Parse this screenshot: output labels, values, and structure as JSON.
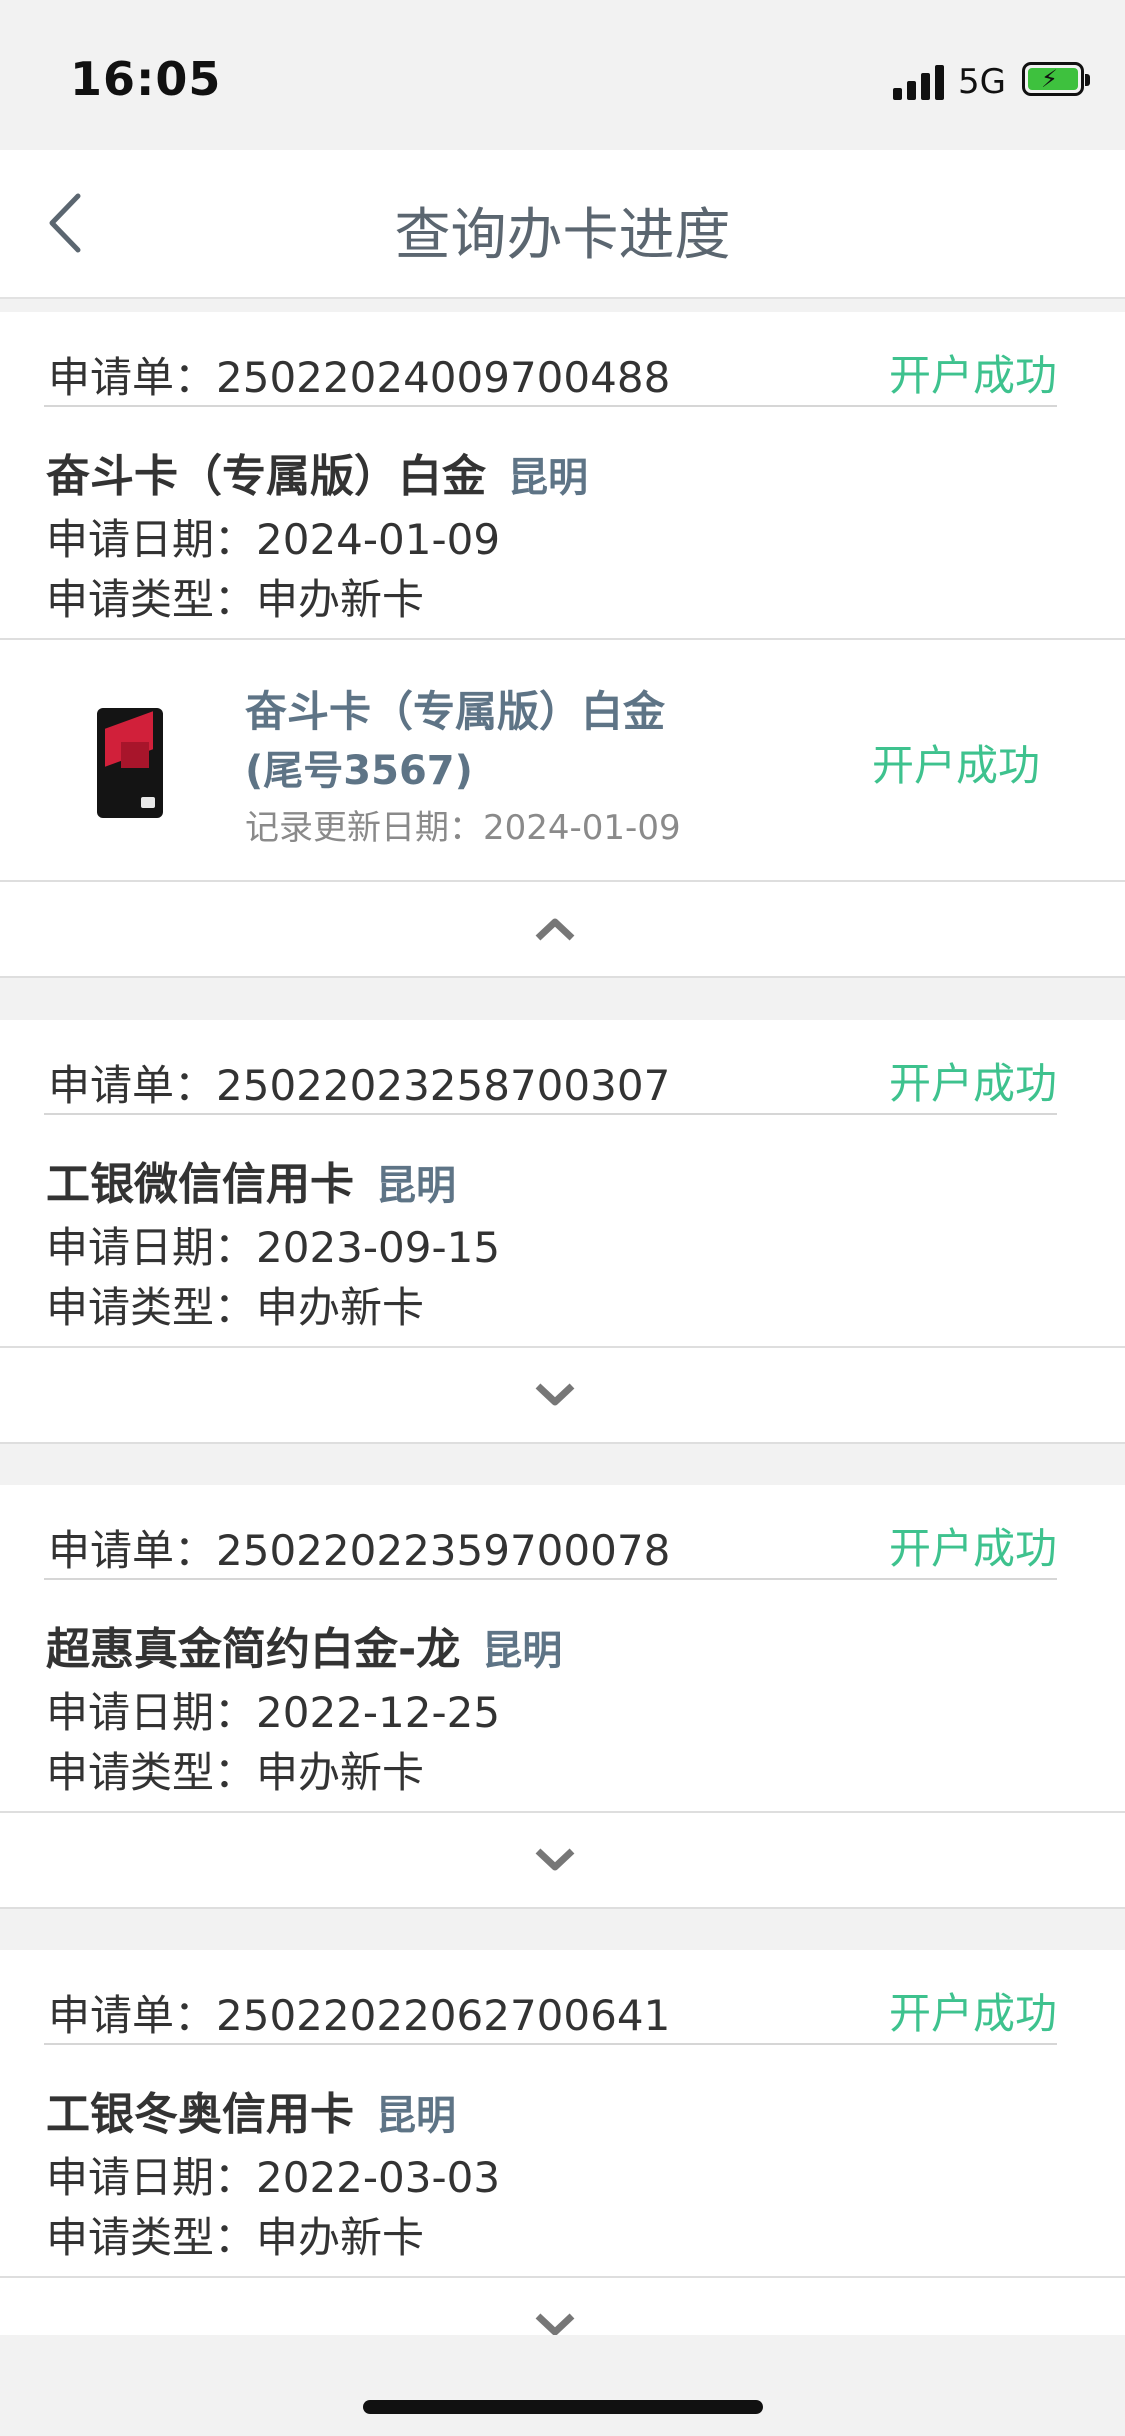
{
  "status_bar": {
    "time": "16:05",
    "network": "5G",
    "icons": [
      "signal-icon",
      "battery-charging-icon"
    ]
  },
  "nav": {
    "title": "查询办卡进度",
    "back_icon": "chevron-left-icon"
  },
  "applications": [
    {
      "label": "申请单：",
      "number": "25022024009700488",
      "status": "开户成功",
      "product": "奋斗卡（专属版）白金",
      "city": "昆明",
      "date_label": "申请日期：",
      "date": "2024-01-09",
      "type_label": "申请类型：",
      "type": "申办新卡",
      "expanded": true,
      "card": {
        "name": "奋斗卡（专属版）白金",
        "tail": "(尾号3567)",
        "update_label": "记录更新日期：",
        "update_date": "2024-01-09",
        "status": "开户成功"
      }
    },
    {
      "label": "申请单：",
      "number": "25022023258700307",
      "status": "开户成功",
      "product": "工银微信信用卡",
      "city": "昆明",
      "date_label": "申请日期：",
      "date": "2023-09-15",
      "type_label": "申请类型：",
      "type": "申办新卡",
      "expanded": false
    },
    {
      "label": "申请单：",
      "number": "25022022359700078",
      "status": "开户成功",
      "product": "超惠真金简约白金-龙",
      "city": "昆明",
      "date_label": "申请日期：",
      "date": "2022-12-25",
      "type_label": "申请类型：",
      "type": "申办新卡",
      "expanded": false
    },
    {
      "label": "申请单：",
      "number": "25022022062700641",
      "status": "开户成功",
      "product": "工银冬奥信用卡",
      "city": "昆明",
      "date_label": "申请日期：",
      "date": "2022-03-03",
      "type_label": "申请类型：",
      "type": "申办新卡",
      "expanded": false
    }
  ],
  "colors": {
    "success": "#3ec28e",
    "accent_text": "#5e7486",
    "nav_title": "#5b6670",
    "background": "#f2f2f2"
  }
}
